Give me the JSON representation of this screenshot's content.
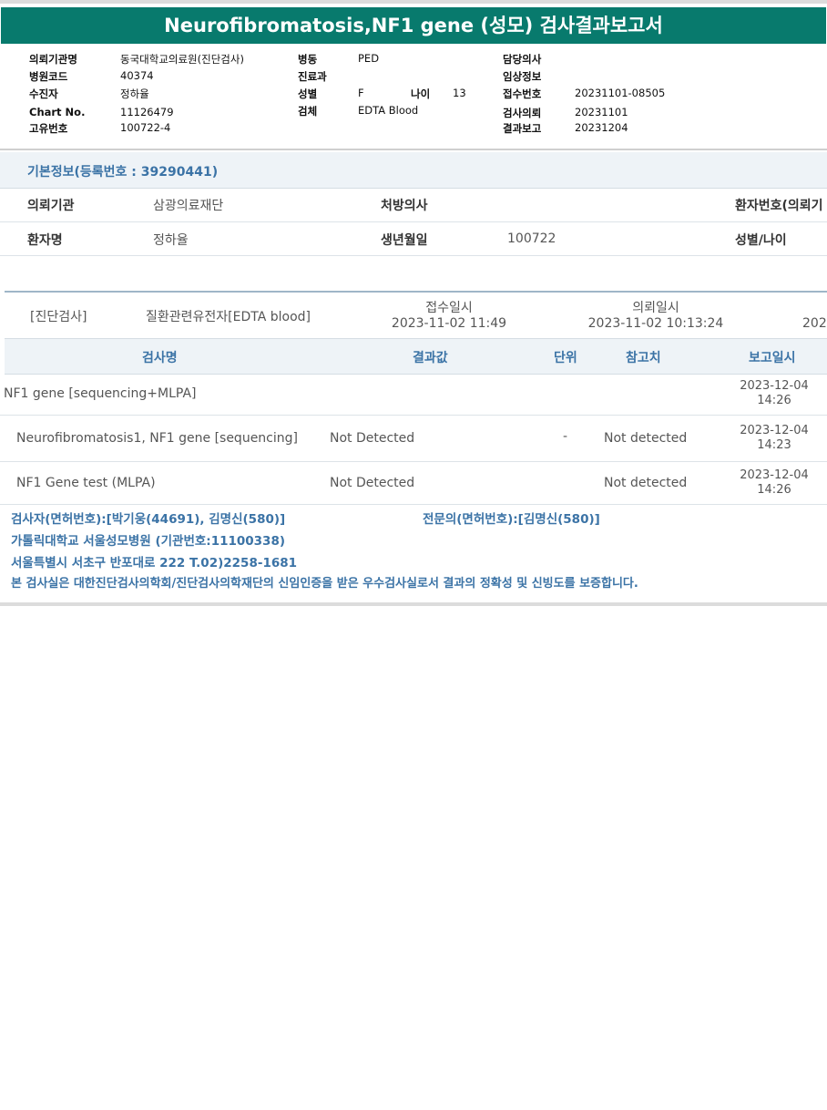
{
  "report_title": "Neurofibromatosis,NF1 gene (성모) 검사결과보고서",
  "header": {
    "col1": [
      {
        "label": "의뢰기관명",
        "value": "동국대학교의료원(진단검사)"
      },
      {
        "label": "병원코드",
        "value": "40374"
      },
      {
        "label": "수진자",
        "value": "정하율"
      },
      {
        "label": "Chart No.",
        "value": "11126479"
      },
      {
        "label": "고유번호",
        "value": "100722-4"
      }
    ],
    "col2": [
      {
        "label": "병동",
        "value": "PED"
      },
      {
        "label": "진료과",
        "value": ""
      },
      {
        "label": "성별",
        "value": "F"
      },
      {
        "label": "검체",
        "value": "EDTA Blood"
      }
    ],
    "age_label": "나이",
    "age_value": "13",
    "col3": [
      {
        "label": "담당의사",
        "value": ""
      },
      {
        "label": "임상정보",
        "value": ""
      },
      {
        "label": "접수번호",
        "value": "20231101-08505"
      },
      {
        "label": "검사의뢰",
        "value": "20231101"
      },
      {
        "label": "결과보고",
        "value": "20231204"
      }
    ]
  },
  "basic_info": {
    "title": "기본정보(등록번호 : 39290441)",
    "row1": {
      "l1": "의뢰기관",
      "v1": "삼광의료재단",
      "l2": "처방의사",
      "v2": "",
      "l3": "환자번호(의뢰기"
    },
    "row2": {
      "l1": "환자명",
      "v1": "정하율",
      "l2": "생년월일",
      "v2": "100722",
      "l3": "성별/나이"
    }
  },
  "order": {
    "category": "[진단검사]",
    "test_group": "질환관련유전자[EDTA blood]",
    "received_label": "접수일시",
    "received_value": "2023-11-02 11:49",
    "requested_label": "의뢰일시",
    "requested_value": "2023-11-02 10:13:24",
    "cut_value": "202"
  },
  "table": {
    "headers": [
      "검사명",
      "결과값",
      "단위",
      "참고치",
      "보고일시"
    ],
    "rows": [
      {
        "name": "NF1 gene [sequencing+MLPA]",
        "result": "",
        "unit": "",
        "ref": "",
        "date": "2023-12-04",
        "time": "14:26"
      },
      {
        "name": "Neurofibromatosis1, NF1 gene [sequencing]",
        "result": "Not Detected",
        "unit": "-",
        "ref": "Not detected",
        "date": "2023-12-04",
        "time": "14:23"
      },
      {
        "name": "NF1 Gene test (MLPA)",
        "result": "Not Detected",
        "unit": "",
        "ref": "Not detected",
        "date": "2023-12-04",
        "time": "14:26"
      }
    ]
  },
  "footer": {
    "examiner": "검사자(면허번호):[박기웅(44691), 김명신(580)]",
    "specialist": "전문의(면허번호):[김명신(580)]",
    "hospital": "가톨릭대학교 서울성모병원 (기관번호:11100338)",
    "address": "서울특별시 서초구 반포대로 222 T.02)2258-1681",
    "certification": "본 검사실은 대한진단검사의학회/진단검사의학재단의 신임인증을 받은 우수검사실로서 결과의 정확성 및 신빙도를 보증합니다."
  }
}
